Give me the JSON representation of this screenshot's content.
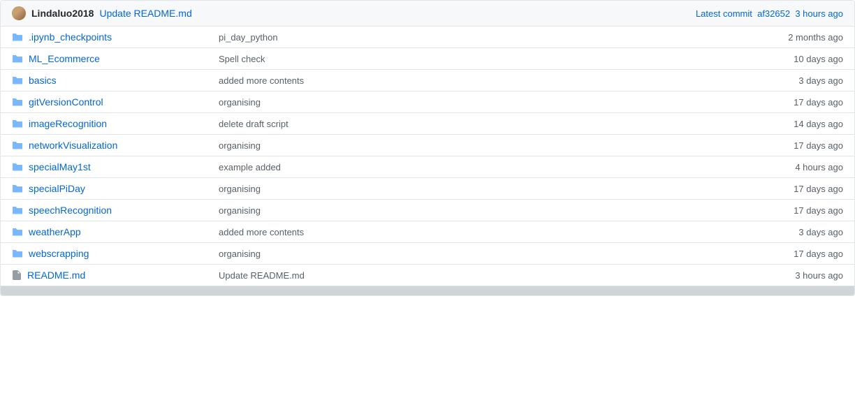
{
  "header": {
    "username": "Lindaluo2018",
    "commit_message": "Update README.md",
    "latest_commit_label": "Latest commit",
    "commit_hash": "af32652",
    "commit_time": "3 hours ago"
  },
  "files": [
    {
      "type": "folder",
      "name": ".ipynb_checkpoints",
      "message": "pi_day_python",
      "time": "2 months ago"
    },
    {
      "type": "folder",
      "name": "ML_Ecommerce",
      "message": "Spell check",
      "time": "10 days ago"
    },
    {
      "type": "folder",
      "name": "basics",
      "message": "added more contents",
      "time": "3 days ago"
    },
    {
      "type": "folder",
      "name": "gitVersionControl",
      "message": "organising",
      "time": "17 days ago"
    },
    {
      "type": "folder",
      "name": "imageRecognition",
      "message": "delete draft script",
      "time": "14 days ago"
    },
    {
      "type": "folder",
      "name": "networkVisualization",
      "message": "organising",
      "time": "17 days ago"
    },
    {
      "type": "folder",
      "name": "specialMay1st",
      "message": "example added",
      "time": "4 hours ago"
    },
    {
      "type": "folder",
      "name": "specialPiDay",
      "message": "organising",
      "time": "17 days ago"
    },
    {
      "type": "folder",
      "name": "speechRecognition",
      "message": "organising",
      "time": "17 days ago"
    },
    {
      "type": "folder",
      "name": "weatherApp",
      "message": "added more contents",
      "time": "3 days ago"
    },
    {
      "type": "folder",
      "name": "webscrapping",
      "message": "organising",
      "time": "17 days ago"
    },
    {
      "type": "file",
      "name": "README.md",
      "message": "Update README.md",
      "time": "3 hours ago"
    }
  ]
}
